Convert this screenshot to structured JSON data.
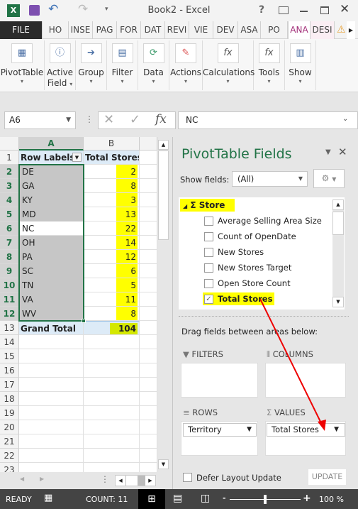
{
  "window": {
    "title": "Book2 - Excel",
    "help": "?"
  },
  "tabs": [
    {
      "label": "FILE"
    },
    {
      "label": "HO"
    },
    {
      "label": "INSE"
    },
    {
      "label": "PAG"
    },
    {
      "label": "FOR"
    },
    {
      "label": "DAT"
    },
    {
      "label": "REVI"
    },
    {
      "label": "VIE"
    },
    {
      "label": "DEV"
    },
    {
      "label": "ASA"
    },
    {
      "label": "PO"
    },
    {
      "label": "ANA"
    },
    {
      "label": "DESI"
    }
  ],
  "ribbon": [
    {
      "label": "PivotTable",
      "label2": "",
      "icon": "pivottable-icon"
    },
    {
      "label": "Active",
      "label2": "Field",
      "icon": "active-field-icon"
    },
    {
      "label": "Group",
      "label2": "",
      "icon": "group-icon"
    },
    {
      "label": "Filter",
      "label2": "",
      "icon": "filter-icon"
    },
    {
      "label": "Data",
      "label2": "",
      "icon": "refresh-icon"
    },
    {
      "label": "Actions",
      "label2": "",
      "icon": "actions-icon"
    },
    {
      "label": "Calculations",
      "label2": "",
      "icon": "calculations-icon"
    },
    {
      "label": "Tools",
      "label2": "",
      "icon": "tools-icon"
    },
    {
      "label": "Show",
      "label2": "",
      "icon": "show-icon"
    }
  ],
  "formula": {
    "name_box": "A6",
    "fx": "fx",
    "value": "NC"
  },
  "sheet": {
    "col_headers": [
      "A",
      "B"
    ],
    "header_row": {
      "row": "1",
      "a": "Row Labels",
      "b": "Total Stores"
    },
    "rows": [
      {
        "row": "2",
        "label": "DE",
        "value": "2"
      },
      {
        "row": "3",
        "label": "GA",
        "value": "8"
      },
      {
        "row": "4",
        "label": "KY",
        "value": "3"
      },
      {
        "row": "5",
        "label": "MD",
        "value": "13"
      },
      {
        "row": "6",
        "label": "NC",
        "value": "22"
      },
      {
        "row": "7",
        "label": "OH",
        "value": "14"
      },
      {
        "row": "8",
        "label": "PA",
        "value": "12"
      },
      {
        "row": "9",
        "label": "SC",
        "value": "6"
      },
      {
        "row": "10",
        "label": "TN",
        "value": "5"
      },
      {
        "row": "11",
        "label": "VA",
        "value": "11"
      },
      {
        "row": "12",
        "label": "WV",
        "value": "8"
      }
    ],
    "total_row": {
      "row": "13",
      "label": "Grand Total",
      "value": "104"
    },
    "empty_rows": [
      "14",
      "15",
      "16",
      "17",
      "18",
      "19",
      "20",
      "21",
      "22",
      "23"
    ],
    "highlight_color": "#ffff00"
  },
  "pane": {
    "title": "PivotTable Fields",
    "show_fields_label": "Show fields:",
    "show_fields_value": "(All)",
    "table_name": "Store",
    "fields": [
      {
        "label": "Average Selling Area Size",
        "checked": false
      },
      {
        "label": "Count of OpenDate",
        "checked": false
      },
      {
        "label": "New Stores",
        "checked": false
      },
      {
        "label": "New Stores Target",
        "checked": false
      },
      {
        "label": "Open Store Count",
        "checked": false
      },
      {
        "label": "Total Stores",
        "checked": true
      }
    ],
    "drag_hint": "Drag fields between areas below:",
    "filters": "FILTERS",
    "columns": "COLUMNS",
    "rows": "ROWS",
    "values": "VALUES",
    "rows_field": "Territory",
    "values_field": "Total Stores",
    "defer": "Defer Layout Update",
    "update": "UPDATE"
  },
  "status": {
    "ready": "READY",
    "count": "COUNT: 11",
    "zoom": "100 %"
  }
}
